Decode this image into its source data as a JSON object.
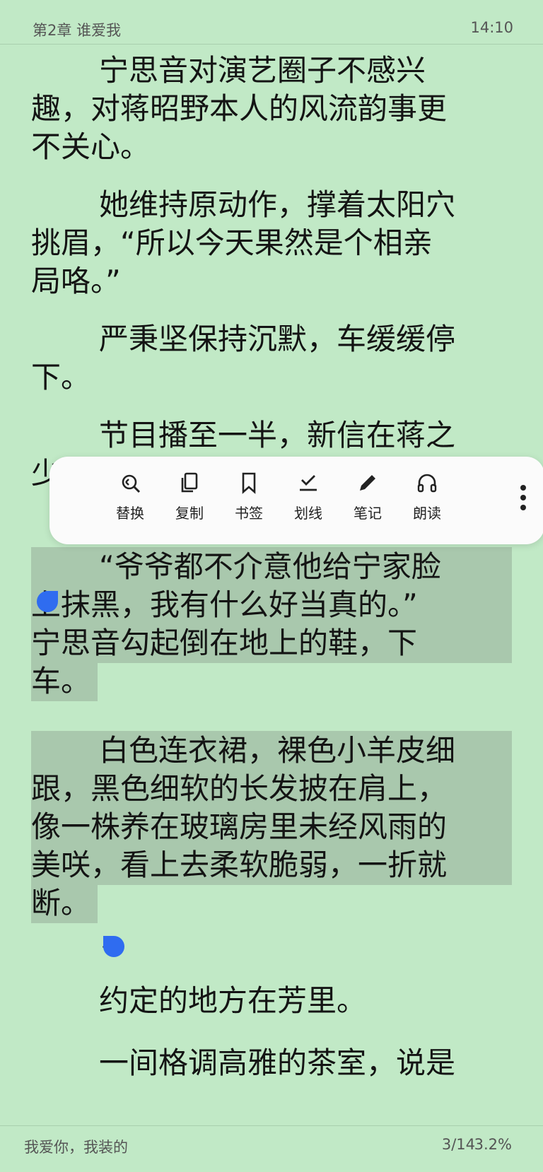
{
  "header": {
    "chapter": "第2章 谁爱我",
    "time": "14:10"
  },
  "content": {
    "lines": [
      "宁思音对演艺圈子不感兴",
      "趣，对蒋昭野本人的风流韵事更",
      "不关心。",
      "她维持原动作，撑着太阳穴",
      "挑眉，“所以今天果然是个相亲",
      "局咯。”",
      "严秉坚保持沉默，车缓缓停",
      "下。",
      "节目播至一半，新信在蒋之",
      "少",
      "“爷爷都不介意他给宁家脸",
      "上抹黑，我有什么好当真的。”",
      "宁思音勾起倒在地上的鞋，下",
      "车。",
      "白色连衣裙，裸色小羊皮细",
      "跟，黑色细软的长发披在肩上，",
      "像一株养在玻璃房里未经风雨的",
      "美咲，看上去柔软脆弱，一折就",
      "断。",
      "–",
      "约定的地方在芳里。",
      "一间格调高雅的茶室，说是"
    ]
  },
  "toolbar": {
    "items": [
      {
        "label": "替换",
        "icon": "replace-icon"
      },
      {
        "label": "复制",
        "icon": "copy-icon"
      },
      {
        "label": "书签",
        "icon": "bookmark-icon"
      },
      {
        "label": "划线",
        "icon": "underline-icon"
      },
      {
        "label": "笔记",
        "icon": "pencil-icon"
      },
      {
        "label": "朗读",
        "icon": "headphones-icon"
      }
    ],
    "more_icon": "more-vertical-icon"
  },
  "footer": {
    "book_title": "我爱你，我装的",
    "page": "3/14",
    "progress": "3.2%"
  },
  "colors": {
    "background": "#c1e9c6",
    "selection": "#a9c8ad",
    "handle": "#2f6cf0",
    "toolbar": "#fbfbfb"
  }
}
